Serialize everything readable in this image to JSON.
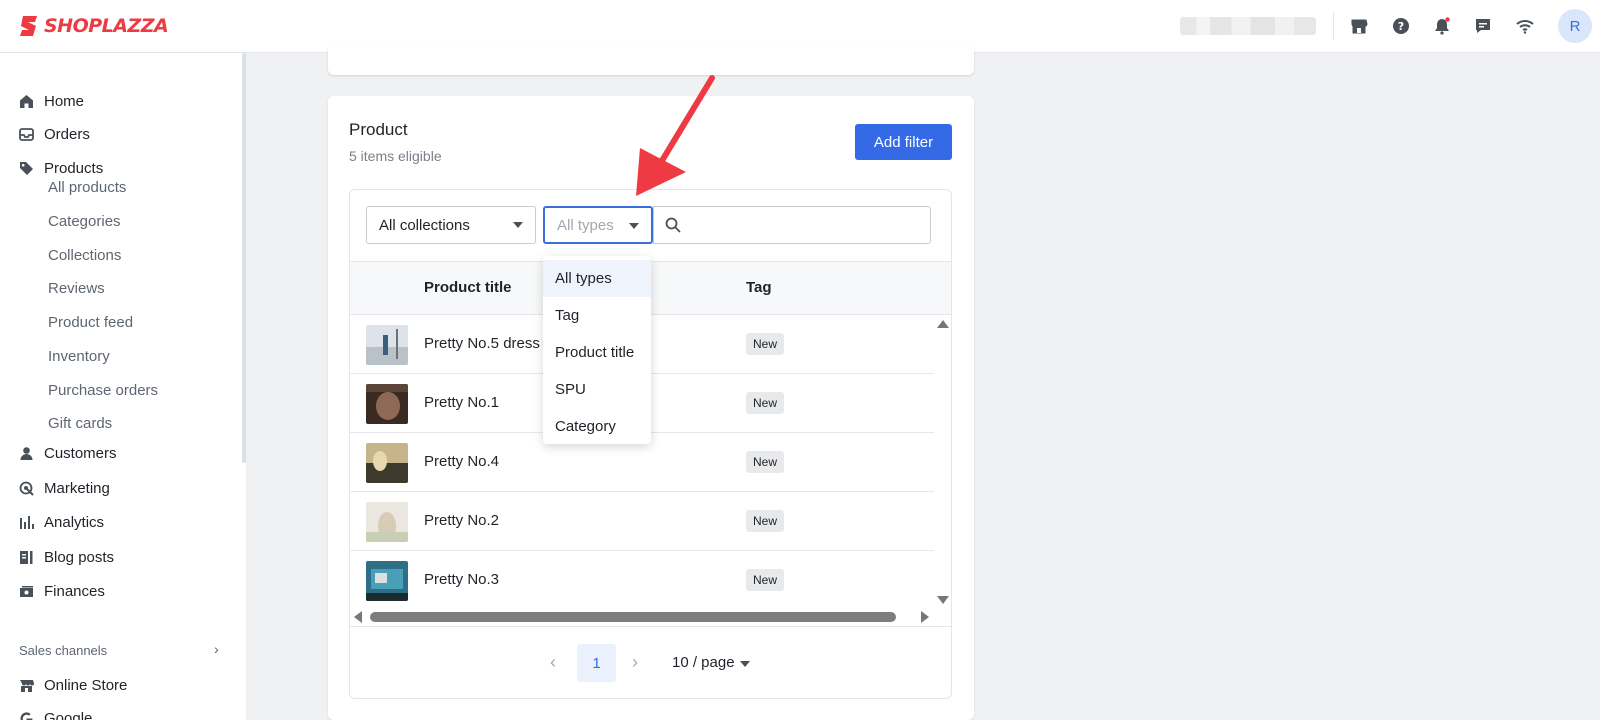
{
  "app": {
    "brand": "SHOPLAZZA",
    "avatar_initial": "R",
    "brand_color": "#ee3a43",
    "accent_color": "#356ae6"
  },
  "topbar": {
    "icons": [
      "store-icon",
      "help-icon",
      "bell-icon",
      "chat-icon",
      "wifi-icon"
    ]
  },
  "sidebar": {
    "items": [
      {
        "label": "Home",
        "icon": "home-icon"
      },
      {
        "label": "Orders",
        "icon": "inbox-icon"
      },
      {
        "label": "Products",
        "icon": "tag-icon"
      },
      {
        "label": "Customers",
        "icon": "person-icon"
      },
      {
        "label": "Marketing",
        "icon": "target-icon"
      },
      {
        "label": "Analytics",
        "icon": "bar-chart-icon"
      },
      {
        "label": "Blog posts",
        "icon": "blog-icon"
      },
      {
        "label": "Finances",
        "icon": "finance-icon"
      }
    ],
    "product_subitems": [
      "All products",
      "Categories",
      "Collections",
      "Reviews",
      "Product feed",
      "Inventory",
      "Purchase orders",
      "Gift cards"
    ],
    "sales_channels_label": "Sales channels",
    "channels": [
      {
        "label": "Online Store",
        "icon": "store-icon"
      },
      {
        "label": "Google",
        "icon": "google-icon"
      }
    ]
  },
  "product_card": {
    "title": "Product",
    "subtitle": "5 items eligible",
    "add_filter_label": "Add filter",
    "collections_select": "All collections",
    "types_select": "All types",
    "search_placeholder": ""
  },
  "type_dropdown": {
    "options": [
      "All types",
      "Tag",
      "Product title",
      "SPU",
      "Category"
    ],
    "selected": "All types"
  },
  "table": {
    "columns": [
      "Product title",
      "Tag"
    ],
    "rows": [
      {
        "title": "Pretty No.5 dress",
        "tag": "New"
      },
      {
        "title": "Pretty No.1",
        "tag": "New"
      },
      {
        "title": "Pretty No.4",
        "tag": "New"
      },
      {
        "title": "Pretty No.2",
        "tag": "New"
      },
      {
        "title": "Pretty No.3",
        "tag": "New"
      }
    ]
  },
  "pagination": {
    "current_page": "1",
    "page_size": "10 / page"
  }
}
